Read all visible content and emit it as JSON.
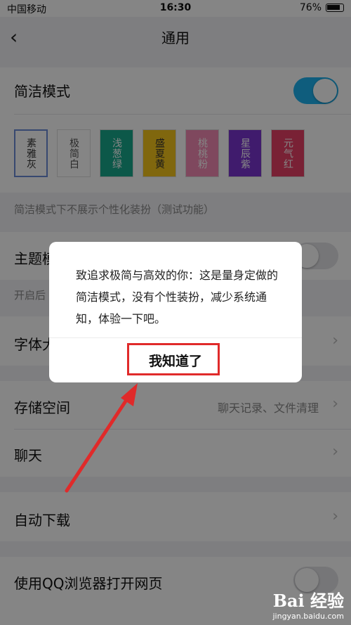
{
  "status_bar": {
    "carrier": "中国移动",
    "time": "16:30",
    "battery": "76%"
  },
  "nav": {
    "back_icon": "chevron-left-icon",
    "title": "通用"
  },
  "simple_mode": {
    "label": "简洁模式",
    "enabled": true,
    "themes": [
      {
        "name": "素雅灰",
        "bg": "#ffffff",
        "fg": "#333333",
        "selected": true
      },
      {
        "name": "极简白",
        "bg": "#ffffff",
        "fg": "#555555",
        "selected": false
      },
      {
        "name": "浅葱绿",
        "bg": "#18a98c",
        "fg": "#ffffff",
        "selected": false
      },
      {
        "name": "盛夏黄",
        "bg": "#f6c51c",
        "fg": "#333333",
        "selected": false
      },
      {
        "name": "桃桃粉",
        "bg": "#f38bb4",
        "fg": "#ffffff",
        "selected": false
      },
      {
        "name": "星辰紫",
        "bg": "#7b35d1",
        "fg": "#ffffff",
        "selected": false
      },
      {
        "name": "元气红",
        "bg": "#e84067",
        "fg": "#ffffff",
        "selected": false
      }
    ],
    "note": "简洁模式下不展示个性化装扮（测试功能）"
  },
  "theme_mode": {
    "label": "主题模",
    "note": "开启后",
    "enabled": false
  },
  "font_size": {
    "label": "字体大"
  },
  "storage": {
    "label": "存储空间",
    "sub": "聊天记录、文件清理"
  },
  "chat": {
    "label": "聊天"
  },
  "auto_download": {
    "label": "自动下载"
  },
  "qq_browser": {
    "label": "使用QQ浏览器打开网页",
    "enabled": false
  },
  "dialog": {
    "message": "致追求极简与高效的你：这是量身定做的简洁模式，没有个性装扮，减少系统通知，体验一下吧。",
    "button": "我知道了"
  },
  "annotation": {
    "color": "#e02a2a"
  },
  "watermark": {
    "brand": "Bai 经验",
    "url": "jingyan.baidu.com"
  }
}
